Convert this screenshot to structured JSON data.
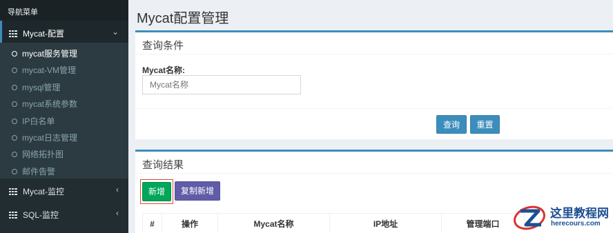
{
  "sidebar": {
    "header": "导航菜单",
    "menus": [
      {
        "label": "Mycat-配置",
        "caret": "⌄"
      },
      {
        "label": "Mycat-监控",
        "caret": "‹"
      },
      {
        "label": "SQL-监控",
        "caret": "‹"
      }
    ],
    "submenu": [
      "mycat服务管理",
      "mycat-VM管理",
      "mysql管理",
      "mycat系统参数",
      "IP白名单",
      "mycat日志管理",
      "网络拓扑图",
      "邮件告警"
    ]
  },
  "page": {
    "title": "Mycat配置管理"
  },
  "query_box": {
    "title": "查询条件",
    "field_label": "Mycat名称:",
    "field_placeholder": "Mycat名称",
    "query_button": "查询",
    "reset_button": "重置"
  },
  "result_box": {
    "title": "查询结果",
    "add_button": "新增",
    "copy_add_button": "复制新增",
    "columns": [
      "#",
      "操作",
      "Mycat名称",
      "IP地址",
      "管理端口"
    ]
  },
  "watermark": {
    "title": "这里教程网",
    "url": "herecours.com"
  },
  "colors": {
    "sidebar_bg": "#222d32",
    "primary": "#3c8dbc",
    "success": "#00a65a",
    "purple": "#605ca8",
    "highlight_border": "#dd4b39"
  }
}
